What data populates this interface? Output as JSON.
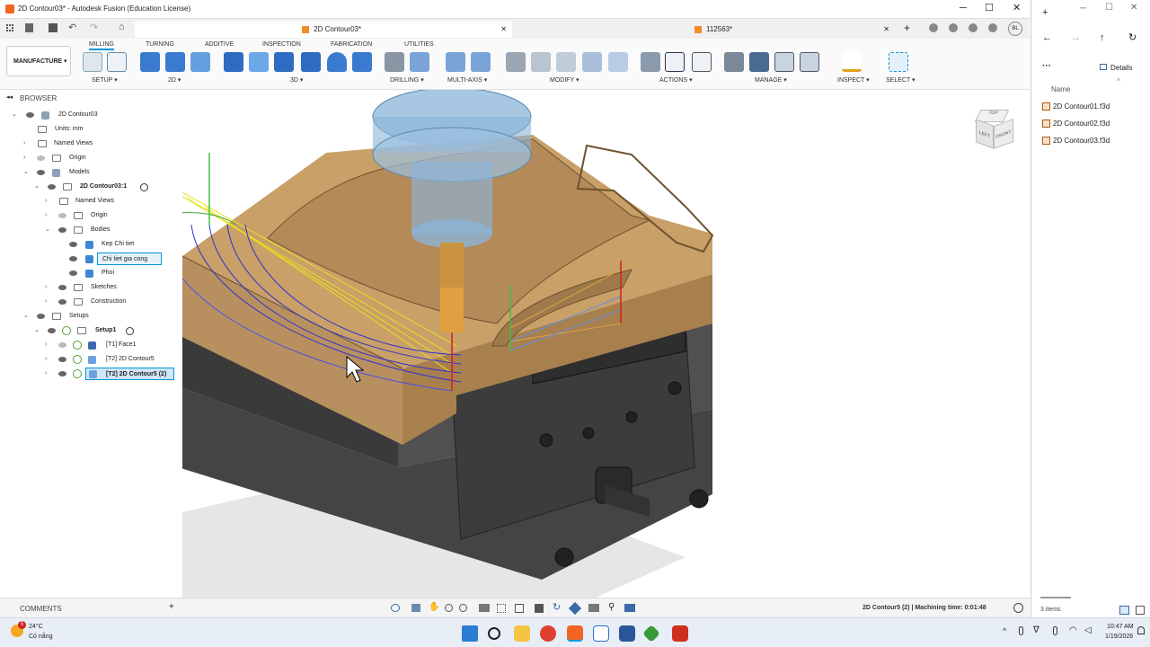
{
  "window": {
    "title": "2D Contour03* - Autodesk Fusion (Education License)"
  },
  "doc_tabs": [
    {
      "label": "2D Contour03*"
    },
    {
      "label": "112563*"
    }
  ],
  "toolbar": {
    "workspace": "MANUFACTURE",
    "tabs": [
      "MILLING",
      "TURNING",
      "ADDITIVE",
      "INSPECTION",
      "FABRICATION",
      "UTILITIES"
    ],
    "groups": [
      "SETUP",
      "2D",
      "3D",
      "DRILLING",
      "MULTI-AXIS",
      "MODIFY",
      "ACTIONS",
      "MANAGE",
      "INSPECT",
      "SELECT"
    ]
  },
  "browser": {
    "header": "BROWSER",
    "rows": [
      {
        "label": "2D Contour03"
      },
      {
        "label": "Units: mm"
      },
      {
        "label": "Named Views"
      },
      {
        "label": "Origin"
      },
      {
        "label": "Models"
      },
      {
        "label": "2D Contour03:1"
      },
      {
        "label": "Named Views"
      },
      {
        "label": "Origin"
      },
      {
        "label": "Bodies"
      },
      {
        "label": "Kep Chi tiet"
      },
      {
        "label": "Chi tiet gia cong"
      },
      {
        "label": "Phoi"
      },
      {
        "label": "Sketches"
      },
      {
        "label": "Construction"
      },
      {
        "label": "Setups"
      },
      {
        "label": "Setup1"
      },
      {
        "label": "[T1] Face1"
      },
      {
        "label": "[T2] 2D Contour5"
      },
      {
        "label": "[T2] 2D Contour5 (2)"
      }
    ]
  },
  "viewcube": {
    "faces": [
      "TOP",
      "LEFT",
      "FRONT"
    ]
  },
  "comments": {
    "label": "COMMENTS"
  },
  "status": {
    "text": "2D Contour5 (2) | Machining time: 0:01:48"
  },
  "explorer": {
    "details": "Details",
    "column": "Name",
    "files": [
      "2D Contour01.f3d",
      "2D Contour02.f3d",
      "2D Contour03.f3d"
    ],
    "count": "3 items"
  },
  "taskbar": {
    "weather_temp": "24°C",
    "weather_desc": "Có nắng",
    "badge": "5",
    "time": "10:47 AM",
    "date": "1/19/2026"
  },
  "colors": {
    "accent": "#0696d7",
    "part": "#c8a068",
    "vise": "#3c3c3c",
    "toolpath_yellow": "#e8e020",
    "toolpath_blue": "#3030d0"
  }
}
